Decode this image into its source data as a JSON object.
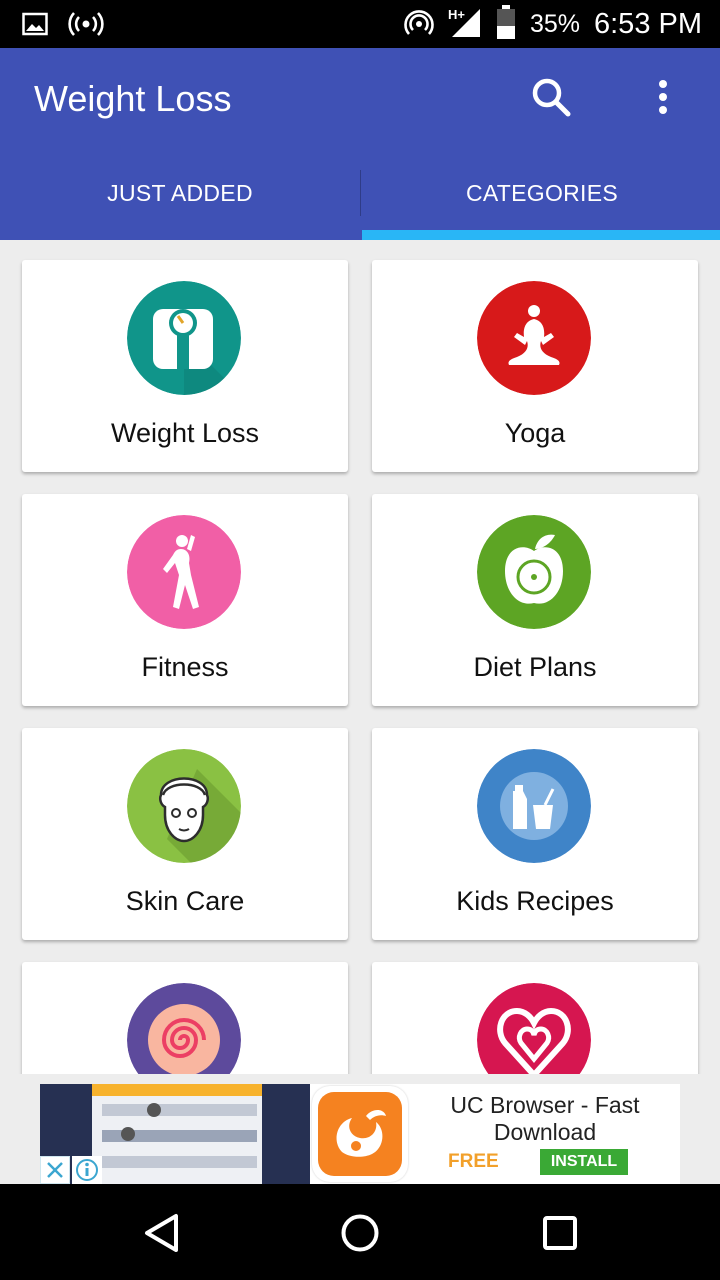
{
  "status_bar": {
    "battery_percent": "35%",
    "time": "6:53 PM",
    "network_type": "H+",
    "icons": [
      "image-notification-icon",
      "hotspot-icon",
      "cast-icon",
      "signal-icon",
      "battery-icon"
    ]
  },
  "app_bar": {
    "title": "Weight Loss",
    "actions": [
      "search-icon",
      "more-vert-icon"
    ]
  },
  "tabs": [
    {
      "label": "JUST ADDED",
      "selected": false
    },
    {
      "label": "CATEGORIES",
      "selected": true
    }
  ],
  "categories": [
    {
      "label": "Weight Loss",
      "icon": "scale-icon",
      "color": "#10958a"
    },
    {
      "label": "Yoga",
      "icon": "yoga-icon",
      "color": "#d7191a"
    },
    {
      "label": "Fitness",
      "icon": "fitness-icon",
      "color": "#f15fa6"
    },
    {
      "label": "Diet Plans",
      "icon": "apple-icon",
      "color": "#5da524"
    },
    {
      "label": "Skin Care",
      "icon": "face-mask-icon",
      "color": "#8ac143"
    },
    {
      "label": "Kids Recipes",
      "icon": "milk-carton-icon",
      "color": "#3f84c8"
    },
    {
      "label": "",
      "icon": "swirl-candy-icon",
      "color": "#5d4a9c"
    },
    {
      "label": "",
      "icon": "heart-icon",
      "color": "#d61650"
    }
  ],
  "ad": {
    "title": "UC Browser - Fast Download",
    "price": "FREE",
    "install_label": "INSTALL",
    "icons": [
      "close-icon",
      "info-icon",
      "uc-browser-logo-icon"
    ]
  },
  "nav_bar": {
    "icons": [
      "back-icon",
      "home-icon",
      "recents-icon"
    ]
  }
}
